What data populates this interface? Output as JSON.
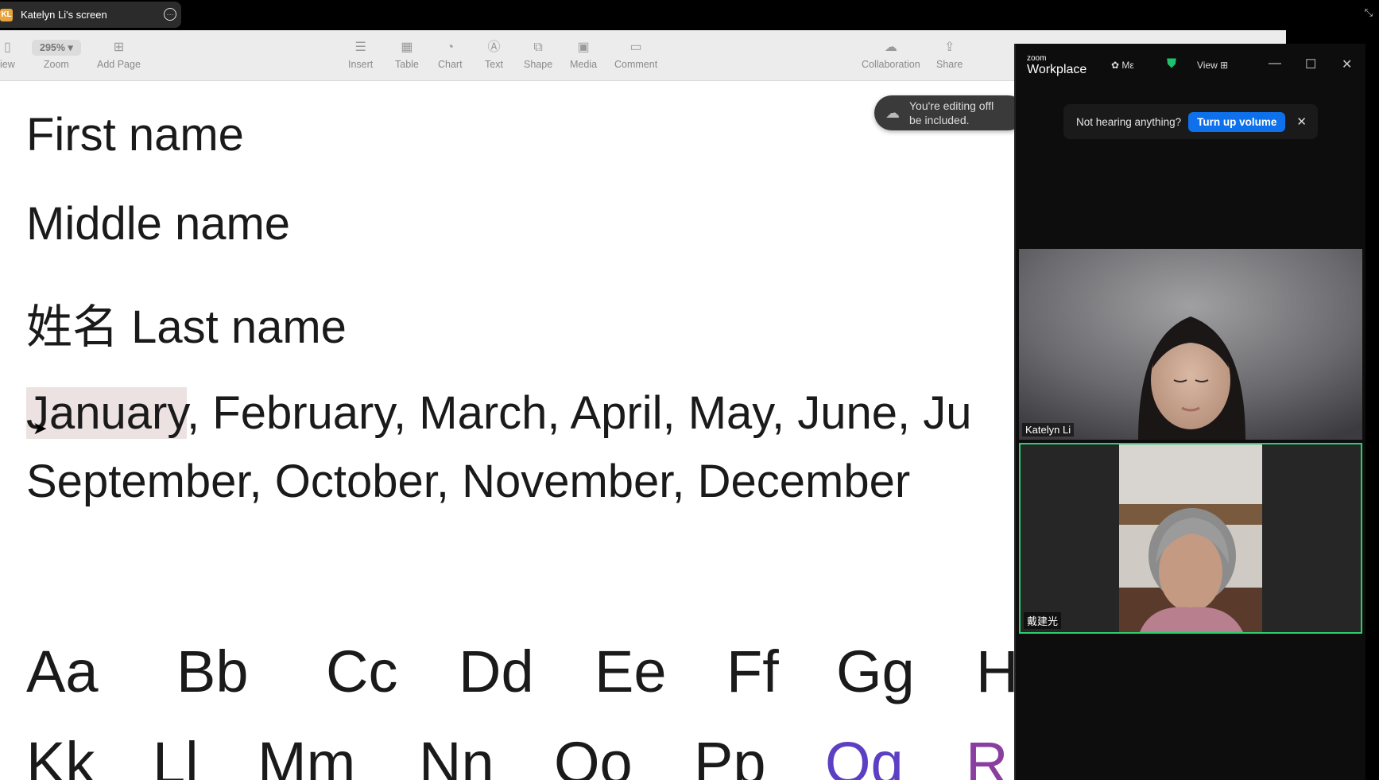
{
  "share": {
    "avatar": "KL",
    "title": "Katelyn Li's screen",
    "more": "···",
    "exit": "⤡"
  },
  "toolbar": {
    "view_partial": "iew",
    "zoom_value": "295%",
    "zoom_label": "Zoom",
    "add_page": "Add Page",
    "insert": "Insert",
    "table": "Table",
    "chart": "Chart",
    "text": "Text",
    "shape": "Shape",
    "media": "Media",
    "comment": "Comment",
    "collaboration": "Collaboration",
    "share": "Share"
  },
  "toast": {
    "line1": "You're editing offl",
    "line2": "be included."
  },
  "document": {
    "first_name": "First name",
    "middle_name": "Middle name",
    "last_name": "姓名 Last name",
    "months_highlight": "January",
    "months_rest1": ", February, March, April, May, June, Ju",
    "months_line2": "September, October, November, December",
    "alphabet_row1": [
      "Aa",
      "Bb",
      "Cc",
      "Dd",
      "Ee",
      "Ff",
      "Gg",
      "H"
    ],
    "alphabet_row2": [
      "Kk",
      "Ll",
      "Mm",
      "Nn",
      "Oo",
      "Pp",
      "Qq",
      "R"
    ]
  },
  "zoom": {
    "logo_small": "zoom",
    "logo_main": "Workplace",
    "meeting_partial": "Mε",
    "view": "View",
    "notice_text": "Not hearing anything?",
    "notice_button": "Turn up volume",
    "notice_close": "✕",
    "participants": [
      {
        "name": "Katelyn Li"
      },
      {
        "name": "戴建光"
      }
    ],
    "colors": {
      "active_speaker": "#2ecc71",
      "button": "#0e71eb"
    }
  }
}
